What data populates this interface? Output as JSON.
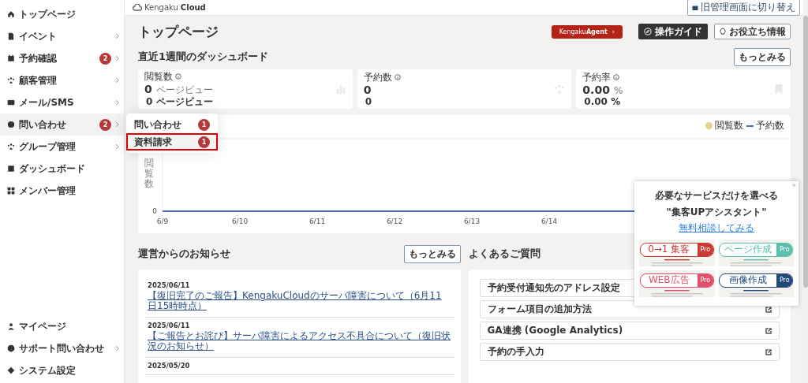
{
  "sidebar": {
    "items": [
      {
        "label": "トップページ",
        "chevron": false,
        "selected": false
      },
      {
        "label": "イベント",
        "chevron": true,
        "selected": false
      },
      {
        "label": "予約確認",
        "badge": "2",
        "chevron": true,
        "selected": false
      },
      {
        "label": "顧客管理",
        "chevron": true,
        "selected": false
      },
      {
        "label": "メール/SMS",
        "chevron": true,
        "selected": false
      },
      {
        "label": "問い合わせ",
        "badge": "2",
        "chevron": true,
        "selected": true
      },
      {
        "label": "グループ管理",
        "chevron": true,
        "selected": false
      },
      {
        "label": "ダッシュボード",
        "chevron": false,
        "selected": false
      },
      {
        "label": "メンバー管理",
        "chevron": false,
        "selected": false
      }
    ],
    "bottom_items": [
      {
        "label": "マイページ",
        "chevron": false
      },
      {
        "label": "サポート問い合わせ",
        "chevron": true
      },
      {
        "label": "システム設定",
        "chevron": false
      }
    ],
    "submenu": [
      {
        "label": "問い合わせ",
        "badge": "1",
        "selected": false
      },
      {
        "label": "資料請求",
        "badge": "1",
        "selected": true
      }
    ]
  },
  "header": {
    "logo_light": "Kengaku",
    "logo_bold": "Cloud",
    "switch_button": "旧管理画面に切り替え"
  },
  "page_title": "トップページ",
  "actions": {
    "agent_light": "Kengaku",
    "agent_bold": "Agent",
    "agent_arrow": "›",
    "guide": "操作ガイド",
    "tips": "お役立ち情報"
  },
  "dashboard": {
    "title": "直近1週間のダッシュボード",
    "more": "もっとみる",
    "stats": [
      {
        "label": "閲覧数",
        "value": "0",
        "unit": "ページビュー",
        "sub": "0 ページビュー"
      },
      {
        "label": "予約数",
        "value": "0",
        "sub": "0"
      },
      {
        "label": "予約率",
        "value": "0.00",
        "unit": "%",
        "sub": "0.00 %"
      }
    ],
    "chart": {
      "ylabel": "閲覧数",
      "y_zero": "0",
      "x_labels": [
        "6/9",
        "6/10",
        "6/11",
        "6/12",
        "6/13",
        "6/14"
      ],
      "legend": [
        {
          "name": "閲覧数",
          "color": "#e8d08e"
        },
        {
          "name": "予約数",
          "color": "#4a6fb8"
        }
      ]
    }
  },
  "news": {
    "title": "運営からのお知らせ",
    "more": "もっとみる",
    "items": [
      {
        "date": "2025/06/11",
        "title": "【復旧完了のご報告】KengakuCloudのサーバ障害について（6月11日15時時点）"
      },
      {
        "date": "2025/06/11",
        "title": "【ご報告とお詫び】サーバ障害によるアクセス不具合について（復旧状況のお知らせ）"
      },
      {
        "date": "2025/05/20"
      }
    ]
  },
  "faq": {
    "title": "よくあるご質問",
    "items": [
      "予約受付通知先のアドレス設定",
      "フォーム項目の追加方法",
      "GA連携 (Google Analytics)",
      "予約の手入力"
    ]
  },
  "promo": {
    "close": "×",
    "line1": "必要なサービスだけを選べる",
    "line2": "\"集客UPアシスタント\"",
    "link": "無料相談してみる",
    "cards": [
      {
        "name": "0→1 集客",
        "pro": "Pro",
        "color": "#c93a32"
      },
      {
        "name": "ページ作成",
        "pro": "Pro",
        "color": "#5cbfae"
      },
      {
        "name": "WEB広告",
        "pro": "Pro",
        "color": "#e0506a"
      },
      {
        "name": "画像作成",
        "pro": "Pro",
        "color": "#1f4a78"
      }
    ]
  }
}
